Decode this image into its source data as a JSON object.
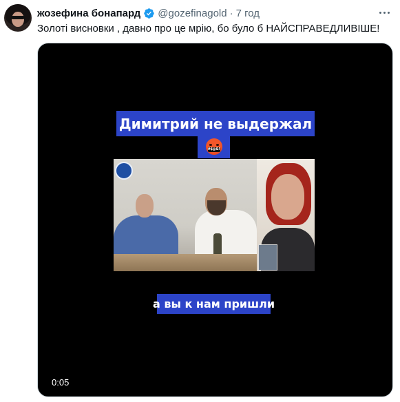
{
  "tweet": {
    "author_name": "жозефина бонапард",
    "handle": "@gozefinagold",
    "separator": "·",
    "time": "7 год",
    "text": "Золоті висновки , давно про це мрію, бо було б НАЙСПРАВЕДЛИВІШЕ!",
    "verified_color": "#1d9bf0"
  },
  "video": {
    "caption_top": "Димитрий не выдержал",
    "emoji": "enraged-face-censored",
    "emoji_label": "#$@&!",
    "caption_bottom": "а вы к нам пришли",
    "timestamp": "0:05",
    "caption_color": "#2c44c8"
  }
}
